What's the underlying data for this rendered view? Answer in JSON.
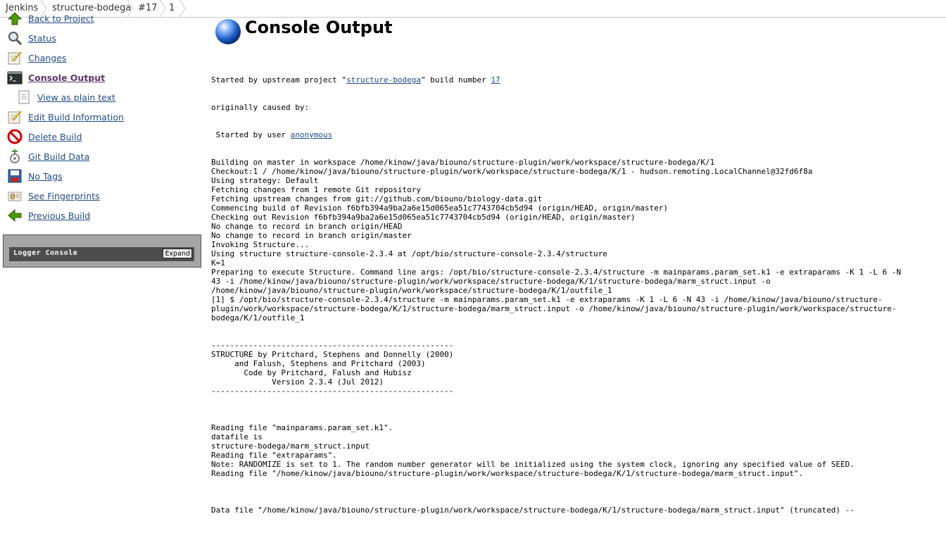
{
  "breadcrumbs": [
    "Jenkins",
    "structure-bodega",
    "#17",
    "1"
  ],
  "sidebar": {
    "items": [
      {
        "label": "Back to Project",
        "icon": "up-arrow-icon"
      },
      {
        "label": "Status",
        "icon": "magnifier-icon"
      },
      {
        "label": "Changes",
        "icon": "notepad-icon"
      },
      {
        "label": "Console Output",
        "icon": "terminal-icon",
        "active": true
      },
      {
        "label": "View as plain text",
        "icon": "document-icon"
      },
      {
        "label": "Edit Build Information",
        "icon": "notepad-pencil-icon"
      },
      {
        "label": "Delete Build",
        "icon": "no-entry-icon"
      },
      {
        "label": "Git Build Data",
        "icon": "git-icon"
      },
      {
        "label": "No Tags",
        "icon": "save-icon"
      },
      {
        "label": "See Fingerprints",
        "icon": "fingerprint-icon"
      },
      {
        "label": "Previous Build",
        "icon": "left-arrow-icon"
      }
    ],
    "logger": {
      "title": "Logger Console",
      "expand_label": "Expand"
    }
  },
  "main": {
    "title": "Console Output",
    "console": {
      "upstream_prefix": "Started by upstream project \"",
      "upstream_project": "structure-bodega",
      "upstream_mid": "\" build number ",
      "upstream_build": "17",
      "caused_by": "originally caused by:",
      "user_prefix": " Started by user ",
      "user": "anonymous",
      "lines": [
        "Building on master in workspace /home/kinow/java/biouno/structure-plugin/work/workspace/structure-bodega/K/1",
        "Checkout:1 / /home/kinow/java/biouno/structure-plugin/work/workspace/structure-bodega/K/1 - hudson.remoting.LocalChannel@32fd6f8a",
        "Using strategy: Default",
        "Fetching changes from 1 remote Git repository",
        "Fetching upstream changes from git://github.com/biouno/biology-data.git",
        "Commencing build of Revision f6bfb394a9ba2a6e15d065ea51c7743704cb5d94 (origin/HEAD, origin/master)",
        "Checking out Revision f6bfb394a9ba2a6e15d065ea51c7743704cb5d94 (origin/HEAD, origin/master)",
        "No change to record in branch origin/HEAD",
        "No change to record in branch origin/master",
        "Invoking Structure...",
        "Using structure structure-console-2.3.4 at /opt/bio/structure-console-2.3.4/structure",
        "K=1",
        "Preparing to execute Structure. Command line args: /opt/bio/structure-console-2.3.4/structure -m mainparams.param_set.k1 -e extraparams -K 1 -L 6 -N",
        "43 -i /home/kinow/java/biouno/structure-plugin/work/workspace/structure-bodega/K/1/structure-bodega/marm_struct.input -o",
        "/home/kinow/java/biouno/structure-plugin/work/workspace/structure-bodega/K/1/outfile_1",
        "[1] $ /opt/bio/structure-console-2.3.4/structure -m mainparams.param_set.k1 -e extraparams -K 1 -L 6 -N 43 -i /home/kinow/java/biouno/structure-",
        "plugin/work/workspace/structure-bodega/K/1/structure-bodega/marm_struct.input -o /home/kinow/java/biouno/structure-plugin/work/workspace/structure-",
        "bodega/K/1/outfile_1",
        "",
        "",
        "----------------------------------------------------",
        "STRUCTURE by Pritchard, Stephens and Donnelly (2000)",
        "     and Falush, Stephens and Pritchard (2003)",
        "       Code by Pritchard, Falush and Hubisz",
        "             Version 2.3.4 (Jul 2012)",
        "----------------------------------------------------",
        "",
        "",
        "",
        "Reading file \"mainparams.param_set.k1\".",
        "datafile is",
        "structure-bodega/marm_struct.input",
        "Reading file \"extraparams\".",
        "Note: RANDOMIZE is set to 1. The random number generator will be initialized using the system clock, ignoring any specified value of SEED.",
        "Reading file \"/home/kinow/java/biouno/structure-plugin/work/workspace/structure-bodega/K/1/structure-bodega/marm_struct.input\".",
        "",
        "",
        "",
        "Data file \"/home/kinow/java/biouno/structure-plugin/work/workspace/structure-bodega/K/1/structure-bodega/marm_struct.input\" (truncated) --"
      ]
    }
  }
}
